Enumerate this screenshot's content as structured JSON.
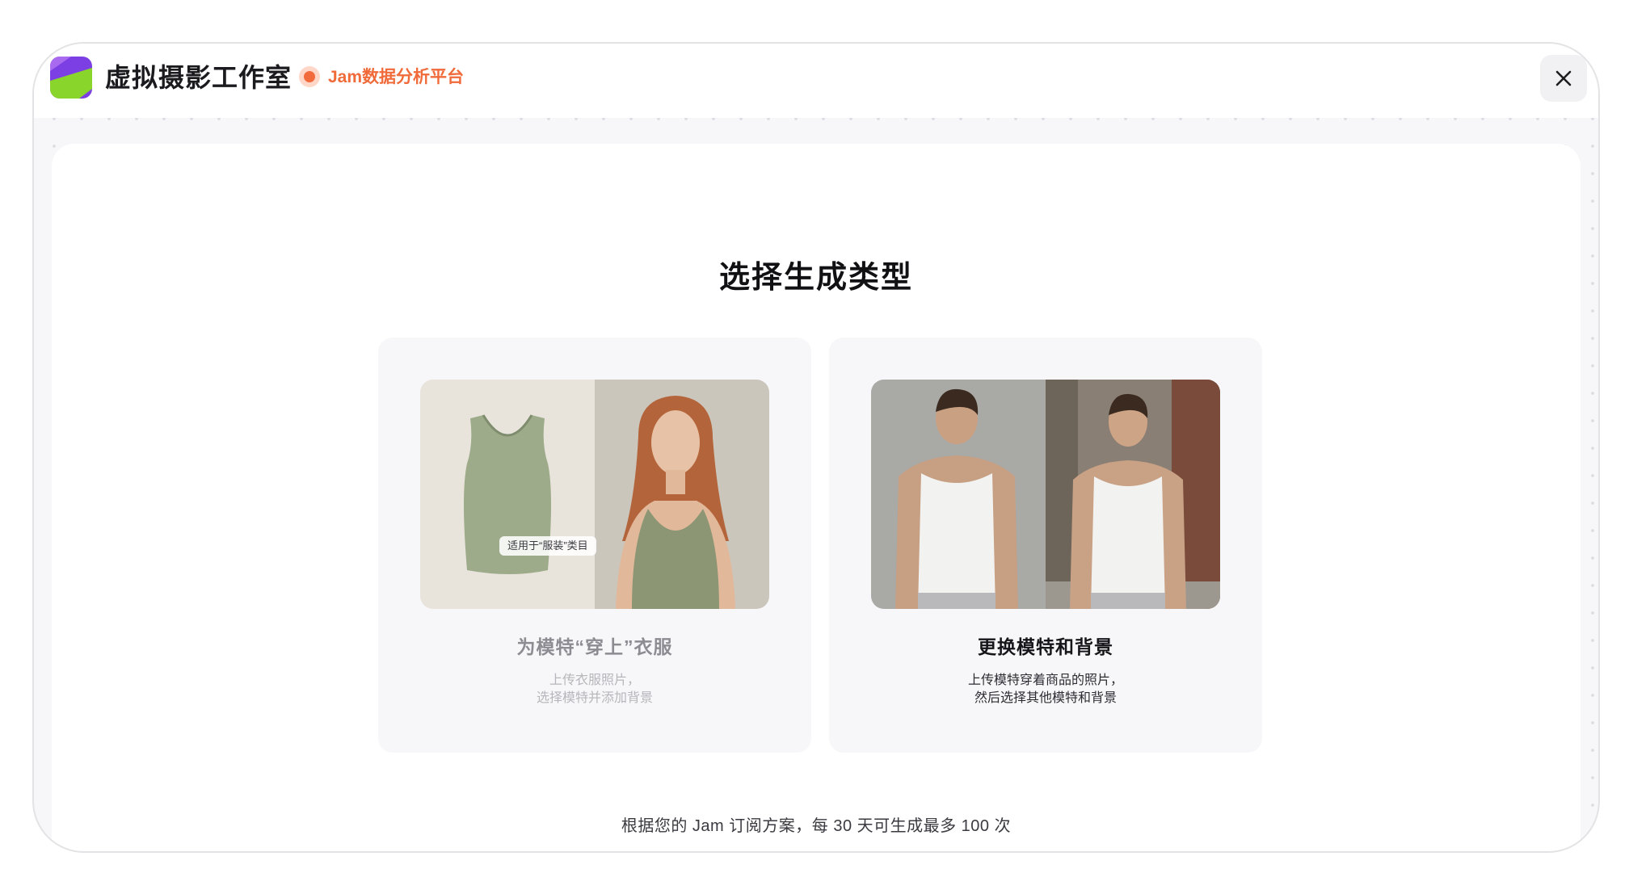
{
  "window": {
    "app_title": "虚拟摄影工作室",
    "platform_label": "Jam数据分析平台",
    "close_icon": "close-icon"
  },
  "main": {
    "title": "选择生成类型",
    "cards": [
      {
        "title": "为模特“穿上”衣服",
        "badge": "适用于“服装”类目",
        "description": [
          "上传衣服照片，",
          "选择模特并添加背景"
        ],
        "image": "tank-top-and-model"
      },
      {
        "title": "更换模特和背景",
        "description": [
          "上传模特穿着商品的照片，",
          "然后选择其他模特和背景"
        ],
        "image": "male-model-swap"
      }
    ],
    "footer_note": "根据您的 Jam 订阅方案，每 30 天可生成最多 100 次"
  },
  "colors": {
    "accent": "#f06a3a",
    "logo_purple": "#7b3fe4",
    "logo_green": "#8ad52b"
  }
}
